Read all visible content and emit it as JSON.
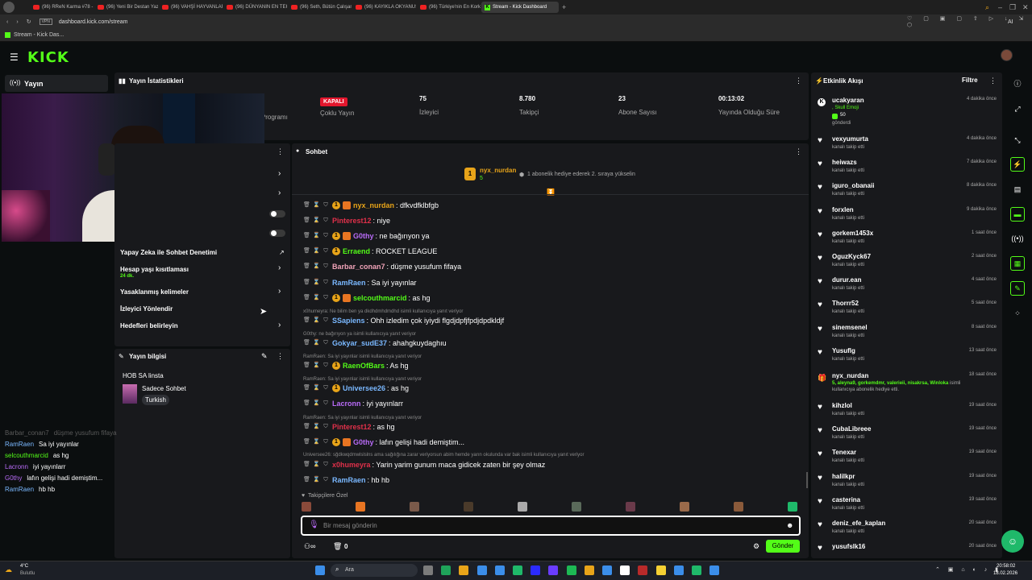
{
  "browser": {
    "tabs": [
      {
        "label": "(96) RReN Karma #78 - Yo"
      },
      {
        "label": "(96) Yeni Bir Destan Yazd"
      },
      {
        "label": "(96) VAHŞİ HAYVANLAR"
      },
      {
        "label": "(96) DÜNYANIN EN TEHL"
      },
      {
        "label": "(96) Seth, Bütün Çalışanla"
      },
      {
        "label": "(96) KAYIKLA OKYANUSU"
      },
      {
        "label": "(96) Türkiye'nin En Korku"
      },
      {
        "label": "Stream - Kick Dashboard"
      }
    ],
    "vpn_label": "VPN",
    "url": "dashboard.kick.com/stream",
    "bookmark": "Stream - Kick Das...",
    "ai_label": "AI"
  },
  "header": {
    "logo": "KICK"
  },
  "nav": {
    "item_label": "Yayın"
  },
  "stats": {
    "title": "Yayın İstatistikleri",
    "status_badge": "KAPALI",
    "partial_label": "r Programı",
    "items": [
      {
        "value": "",
        "label": "Çoklu Yayın"
      },
      {
        "value": "75",
        "label": "İzleyici"
      },
      {
        "value": "8.780",
        "label": "Takipçi"
      },
      {
        "value": "23",
        "label": "Abone Sayısı"
      },
      {
        "value": "00:13:02",
        "label": "Yayında Olduğu Süre"
      }
    ]
  },
  "settings": {
    "rows": [
      {
        "label": "Yapay Zeka ile Sohbet Denetimi",
        "sub": ""
      },
      {
        "label": "Hesap yaşı kısıtlaması",
        "sub": "24 dk."
      },
      {
        "label": "Yasaklanmış kelimeler",
        "sub": ""
      },
      {
        "label": "İzleyici Yönlendir",
        "sub": ""
      },
      {
        "label": "Hedefleri belirleyin",
        "sub": ""
      }
    ]
  },
  "stream_info": {
    "title": "Yayın bilgisi",
    "stream_title": "HOB SA linsta",
    "category": "Sadece Sohbet",
    "language_tag": "Turkish"
  },
  "chat": {
    "title": "Sohbet",
    "pinned_user": "nyx_nurdan",
    "pinned_count": "5",
    "pinned_text": "1 abonelik hediye ederek 2. sıraya yükselin",
    "messages": [
      {
        "user": "nyx_nurdan",
        "color": "#e8a419",
        "text": ": dfkvdfklbfgb",
        "badge": true,
        "heart": true,
        "reply": ""
      },
      {
        "user": "Pinterest12",
        "color": "#e0304a",
        "text": ": niye",
        "badge": false,
        "heart": false,
        "reply": ""
      },
      {
        "user": "G0thy",
        "color": "#b86bf7",
        "text": ": ne bağırıyon ya",
        "badge": true,
        "heart": true,
        "reply": ""
      },
      {
        "user": "Erraend",
        "color": "#53fc18",
        "text": ": ROCKET LEAGUE",
        "badge": true,
        "heart": false,
        "reply": ""
      },
      {
        "user": "Barbar_conan7",
        "color": "#f0a3b8",
        "text": ": düşme yusufum fifaya",
        "badge": false,
        "heart": false,
        "reply": ""
      },
      {
        "user": "RamRaen",
        "color": "#7ab8ff",
        "text": ": Sa iyi yayınlar",
        "badge": false,
        "heart": false,
        "reply": ""
      },
      {
        "user": "selcouthmarcid",
        "color": "#53fc18",
        "text": ": as hg",
        "badge": true,
        "heart": true,
        "reply": ""
      },
      {
        "user": "SSapiens",
        "color": "#7ab8ff",
        "text": ": Ohh izledim çok iyiydi flgdjdpfjfpdjdpdkldjf",
        "badge": false,
        "heart": false,
        "reply": "x0humeyra: Ne bilim ben ya dkdhdmhdmdhd isimli kullanıcıya yanıt veriyor"
      },
      {
        "user": "Gokyar_sudE37",
        "color": "#7ab8ff",
        "text": ": ahahgkuydaghıu",
        "badge": false,
        "heart": false,
        "reply": "G0thy: ne bağırıyon ya isimli kullanıcıya yanıt veriyor"
      },
      {
        "user": "RaenOfBars",
        "color": "#53fc18",
        "text": ": As hg",
        "badge": true,
        "heart": false,
        "reply": "RamRaen: Sa iyi yayınlar isimli kullanıcıya yanıt veriyor"
      },
      {
        "user": "Universee26",
        "color": "#7ab8ff",
        "text": ": as hg",
        "badge": true,
        "heart": false,
        "reply": "RamRaen: Sa iyi yayınlar isimli kullanıcıya yanıt veriyor"
      },
      {
        "user": "Lacronn",
        "color": "#b86bf7",
        "text": ": iyi yayınlarr",
        "badge": false,
        "heart": false,
        "reply": ""
      },
      {
        "user": "Pinterest12",
        "color": "#e0304a",
        "text": ": as hg",
        "badge": false,
        "heart": false,
        "reply": "RamRaen: Sa iyi yayınlar isimli kullanıcıya yanıt veriyor"
      },
      {
        "user": "G0thy",
        "color": "#b86bf7",
        "text": ": lafın gelişi hadi demiştim...",
        "badge": true,
        "heart": true,
        "reply": ""
      },
      {
        "user": "x0humeyra",
        "color": "#e0304a",
        "text": ": Yarin yarim gunum maca gidicek zaten bir şey olmaz",
        "badge": false,
        "heart": false,
        "reply": "Universee26: sğdkwqdmwlslslns ama sağılığına zarar veriyorsun abim hemde yarın okulunda var bak isimli kullanıcıya yanıt veriyor"
      },
      {
        "user": "RamRaen",
        "color": "#7ab8ff",
        "text": ": hb hb",
        "badge": false,
        "heart": false,
        "reply": ""
      }
    ],
    "emote_section": "Takipçilere Özel",
    "input_placeholder": "Bir mesaj gönderin",
    "counter": "0",
    "send_label": "Gönder"
  },
  "activity": {
    "title": "Etkinlik Akışı",
    "filter_label": "Filtre",
    "first": {
      "user": "ucakyaran",
      "item": ", Skull Emoji",
      "amount": "50",
      "sub": "gönderdi",
      "time": "4 dakika önce"
    },
    "items": [
      {
        "user": "vexyumurta",
        "sub": "kanalı takip etti",
        "time": "4 dakika önce"
      },
      {
        "user": "heiwazs",
        "sub": "kanalı takip etti",
        "time": "7 dakika önce"
      },
      {
        "user": "iguro_obanaii",
        "sub": "kanalı takip etti",
        "time": "8 dakika önce"
      },
      {
        "user": "forxlen",
        "sub": "kanalı takip etti",
        "time": "9 dakika önce"
      },
      {
        "user": "gorkem1453x",
        "sub": "kanalı takip etti",
        "time": "1 saat önce"
      },
      {
        "user": "OguzKyck67",
        "sub": "kanalı takip etti",
        "time": "2 saat önce"
      },
      {
        "user": "durur.ean",
        "sub": "kanalı takip etti",
        "time": "4 saat önce"
      },
      {
        "user": "Thorrr52",
        "sub": "kanalı takip etti",
        "time": "5 saat önce"
      },
      {
        "user": "sinemsenel",
        "sub": "kanalı takip etti",
        "time": "8 saat önce"
      },
      {
        "user": "Yusuflg",
        "sub": "kanalı takip etti",
        "time": "13 saat önce"
      }
    ],
    "gift": {
      "user": "nyx_nurdan",
      "names": "5, aleyna9, gorkemdmr, valerieii, nisakrsa, Winloka",
      "rest": " isimli",
      "sub": "kullanıcıya abonelik hediye etti.",
      "time": "18 saat önce"
    },
    "items2": [
      {
        "user": "kihzlol",
        "sub": "kanalı takip etti",
        "time": "19 saat önce"
      },
      {
        "user": "CubaLibreee",
        "sub": "kanalı takip etti",
        "time": "19 saat önce"
      },
      {
        "user": "Tenexar",
        "sub": "kanalı takip etti",
        "time": "19 saat önce"
      },
      {
        "user": "halilkpr",
        "sub": "kanalı takip etti",
        "time": "19 saat önce"
      },
      {
        "user": "casterina",
        "sub": "kanalı takip etti",
        "time": "19 saat önce"
      },
      {
        "user": "deniz_efe_kaplan",
        "sub": "kanalı takip etti",
        "time": "20 saat önce"
      },
      {
        "user": "yusufslk16",
        "sub": "",
        "time": "20 saat önce"
      }
    ]
  },
  "overlay_chat": [
    {
      "user": "Barbar_conan7",
      "text": "düşme yusufum fifaya",
      "color": "#5a5a5a",
      "tcolor": "#5a5a5a"
    },
    {
      "user": "RamRaen",
      "text": "Sa iyi yayınlar",
      "color": "#7ab8ff",
      "tcolor": "#ffffff"
    },
    {
      "user": "selcouthmarcid",
      "text": "as hg",
      "color": "#53fc18",
      "tcolor": "#ffffff"
    },
    {
      "user": "Lacronn",
      "text": "iyi yayınlarr",
      "color": "#b86bf7",
      "tcolor": "#ffffff"
    },
    {
      "user": "G0thy",
      "text": "lafın gelişi hadi demiştim...",
      "color": "#b86bf7",
      "tcolor": "#ffffff"
    },
    {
      "user": "RamRaen",
      "text": "hb hb",
      "color": "#7ab8ff",
      "tcolor": "#ffffff"
    }
  ],
  "taskbar": {
    "weather_temp": "4°C",
    "weather_desc": "Bulutlu",
    "search_label": "Ara",
    "time": "20:58:02",
    "date": "18.02.2026"
  },
  "colors": {
    "accent": "#53fc18",
    "panel": "#18191c",
    "background": "#0b0e0f"
  }
}
